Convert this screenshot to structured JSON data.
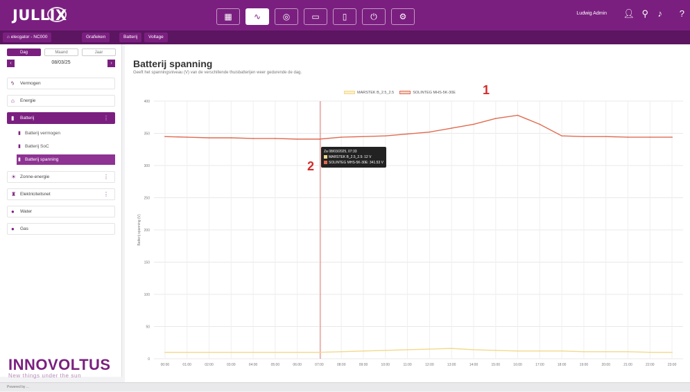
{
  "app": {
    "logo": "JULLIX",
    "nav_icons": [
      "dashboard-icon",
      "chart-icon",
      "brain-icon",
      "battery-icon",
      "device-icon",
      "plug-icon",
      "gear-icon"
    ],
    "active_nav_index": 1,
    "user": "Ludwig Admin"
  },
  "breadcrumb": [
    "elecgator - NC000",
    "Grafieken",
    "Batterij",
    "Voltage"
  ],
  "sidebar": {
    "period_tabs": [
      "Dag",
      "Maand",
      "Jaar"
    ],
    "active_period": 0,
    "date": "08/03/25",
    "items": [
      {
        "label": "Vermogen",
        "icon": "lightning-icon",
        "active": false
      },
      {
        "label": "Energie",
        "icon": "home-icon",
        "active": false
      },
      {
        "label": "Batterij",
        "icon": "battery-icon",
        "active": true
      },
      {
        "label": "Zonne-energie",
        "icon": "sun-icon",
        "active": false
      },
      {
        "label": "Elektriciteitsnet",
        "icon": "tower-icon",
        "active": false
      },
      {
        "label": "Water",
        "icon": "water-icon",
        "active": false
      },
      {
        "label": "Gas",
        "icon": "gas-icon",
        "active": false
      }
    ],
    "subitems": [
      {
        "label": "Batterij vermogen",
        "active": false
      },
      {
        "label": "Batterij SoC",
        "active": false
      },
      {
        "label": "Batterij spanning",
        "active": true
      }
    ]
  },
  "brand": {
    "name": "INNOVOLTUS",
    "tagline": "New things under the sun"
  },
  "footer": {
    "text": "Powered by ..."
  },
  "page": {
    "title": "Batterij spanning",
    "subtitle": "Geeft het spanningsniveau (V) van de verschillende thuisbatterijen weer gedurende de dag."
  },
  "annotations": {
    "one": "1",
    "two": "2"
  },
  "tooltip": {
    "header": "Za 08/03/2025, 07:33",
    "rows": [
      {
        "label": "MARSTEK B_2.5_2.5: 12 V",
        "color": "#f2d98a"
      },
      {
        "label": "SOLINTEG MHS-5K-30E: 341.53 V",
        "color": "#e06a4f"
      }
    ]
  },
  "chart_data": {
    "type": "line",
    "ylabel": "Batterij spanning (V)",
    "ylim": [
      0,
      400
    ],
    "yticks": [
      0,
      50,
      100,
      150,
      200,
      250,
      300,
      350,
      400
    ],
    "x": [
      "00:00",
      "01:00",
      "02:00",
      "03:00",
      "04:00",
      "05:00",
      "06:00",
      "07:00",
      "08:00",
      "09:00",
      "10:00",
      "11:00",
      "12:00",
      "13:00",
      "14:00",
      "15:00",
      "16:00",
      "17:00",
      "18:00",
      "19:00",
      "20:00",
      "21:00",
      "22:00",
      "23:00"
    ],
    "colors": {
      "orange": "#e06a4f",
      "yellow": "#f2d98a"
    },
    "series": [
      {
        "name": "MARSTEK B_2.5_2.5",
        "color": "#f2d98a",
        "values": [
          10,
          10,
          10,
          10,
          10,
          10,
          10,
          10,
          11,
          12,
          13,
          14,
          15,
          16,
          14,
          13,
          12,
          12,
          12,
          11,
          11,
          11,
          10,
          10
        ]
      },
      {
        "name": "SOLINTEG MHS-5K-30E",
        "color": "#e06a4f",
        "values": [
          345,
          344,
          343,
          343,
          342,
          342,
          341,
          341,
          344,
          345,
          346,
          349,
          352,
          358,
          364,
          373,
          378,
          364,
          346,
          345,
          345,
          344,
          344,
          344
        ]
      }
    ]
  }
}
